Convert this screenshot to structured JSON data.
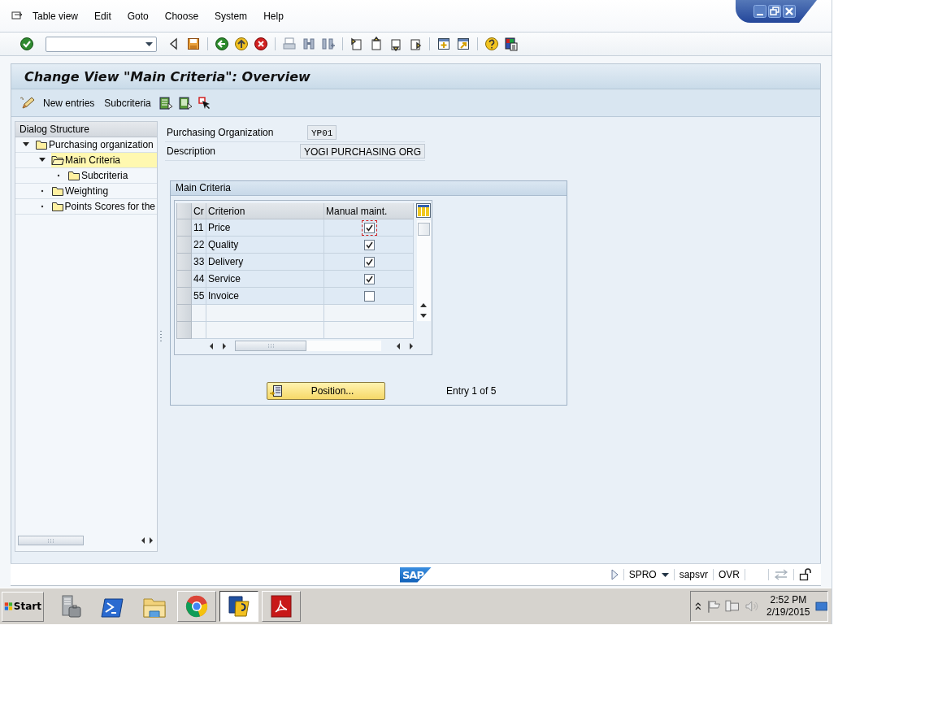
{
  "menu": [
    "Table view",
    "Edit",
    "Goto",
    "Choose",
    "System",
    "Help"
  ],
  "title": "Change View \"Main Criteria\": Overview",
  "app_toolbar": [
    "New entries",
    "Subcriteria"
  ],
  "dialog_structure": {
    "title": "Dialog Structure",
    "items": [
      {
        "label": "Purchasing organization",
        "expanded": true,
        "selected": false,
        "children": [
          {
            "label": "Main Criteria",
            "expanded": true,
            "selected": true,
            "children": [
              {
                "label": "Subcriteria",
                "expanded": false,
                "selected": false
              }
            ]
          },
          {
            "label": "Weighting",
            "expanded": false,
            "selected": false
          },
          {
            "label": "Points Scores for the",
            "expanded": false,
            "selected": false
          }
        ]
      }
    ]
  },
  "fields": [
    {
      "label": "Purchasing Organization",
      "value": "YP01"
    },
    {
      "label": "Description",
      "value": "YOGI PURCHASING ORG"
    }
  ],
  "table": {
    "title": "Main Criteria",
    "columns": [
      "Cr",
      "Criterion",
      "Manual maint."
    ],
    "rows": [
      {
        "cr": "11",
        "criterion": "Price",
        "checked": true,
        "focused": true
      },
      {
        "cr": "22",
        "criterion": "Quality",
        "checked": true,
        "focused": false
      },
      {
        "cr": "33",
        "criterion": "Delivery",
        "checked": true,
        "focused": false
      },
      {
        "cr": "44",
        "criterion": "Service",
        "checked": true,
        "focused": false
      },
      {
        "cr": "55",
        "criterion": "Invoice",
        "checked": false,
        "focused": false
      }
    ]
  },
  "position_button": "Position...",
  "entry_info": "Entry 1 of 5",
  "status_bar": {
    "logo": "SAP",
    "transaction": "SPRO",
    "server": "sapsvr",
    "mode": "OVR"
  },
  "taskbar": {
    "start": "Start",
    "apps": [
      {
        "kind": "server",
        "running": false,
        "selected": false
      },
      {
        "kind": "shell",
        "running": false,
        "selected": false
      },
      {
        "kind": "folder",
        "running": false,
        "selected": false
      },
      {
        "kind": "browser",
        "running": true,
        "selected": false
      },
      {
        "kind": "sap",
        "running": true,
        "selected": true
      },
      {
        "kind": "pdf",
        "running": true,
        "selected": false
      }
    ],
    "time": "2:52 PM",
    "date": "2/19/2015"
  }
}
